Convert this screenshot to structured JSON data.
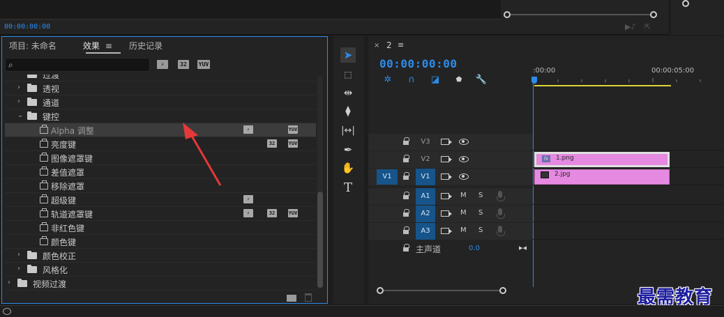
{
  "top": {
    "timecode": "00:00:00:00"
  },
  "effects_panel": {
    "tabs": [
      {
        "label": "项目: 未命名"
      },
      {
        "label": "效果"
      },
      {
        "label": "历史记录"
      }
    ],
    "active_tab": "效果",
    "search": {
      "value": "",
      "placeholder": ""
    },
    "filter_badges": [
      "accel-badge-icon",
      "32-bit-badge-icon",
      "yuv-badge-icon"
    ],
    "filter_badge_labels": [
      "⚡",
      "32",
      "YUV"
    ],
    "tree": [
      {
        "label": "过渡",
        "type": "folder",
        "depth": 1,
        "collapsed": true
      },
      {
        "label": "透视",
        "type": "folder",
        "depth": 1,
        "collapsed": true
      },
      {
        "label": "通道",
        "type": "folder",
        "depth": 1,
        "collapsed": true
      },
      {
        "label": "键控",
        "type": "folder",
        "depth": 1,
        "collapsed": false
      },
      {
        "label": "Alpha 调整",
        "type": "effect",
        "depth": 2,
        "selected": true,
        "badges": [
          "accel",
          "yuv"
        ]
      },
      {
        "label": "亮度键",
        "type": "effect",
        "depth": 2,
        "badges": [
          "32",
          "yuv"
        ]
      },
      {
        "label": "图像遮罩键",
        "type": "effect",
        "depth": 2,
        "badges": []
      },
      {
        "label": "差值遮罩",
        "type": "effect",
        "depth": 2,
        "badges": []
      },
      {
        "label": "移除遮罩",
        "type": "effect",
        "depth": 2,
        "badges": []
      },
      {
        "label": "超级键",
        "type": "effect",
        "depth": 2,
        "badges": [
          "accel"
        ]
      },
      {
        "label": "轨道遮罩键",
        "type": "effect",
        "depth": 2,
        "badges": [
          "accel",
          "32",
          "yuv"
        ]
      },
      {
        "label": "非红色键",
        "type": "effect",
        "depth": 2,
        "badges": []
      },
      {
        "label": "颜色键",
        "type": "effect",
        "depth": 2,
        "badges": []
      },
      {
        "label": "颜色校正",
        "type": "folder",
        "depth": 1,
        "collapsed": true
      },
      {
        "label": "风格化",
        "type": "folder",
        "depth": 1,
        "collapsed": true
      },
      {
        "label": "视频过渡",
        "type": "folder",
        "depth": 0,
        "collapsed": true
      }
    ]
  },
  "tools": [
    "selection-tool-icon",
    "track-select-tool-icon",
    "ripple-edit-tool-icon",
    "razor-tool-icon",
    "slip-tool-icon",
    "pen-tool-icon",
    "hand-tool-icon",
    "type-tool-icon"
  ],
  "timeline": {
    "sequence_name": "2",
    "timecode": "00:00:00:00",
    "ruler": {
      "start": ":00:00",
      "end": "00:00:05:00"
    },
    "video_tracks": [
      {
        "name": "V3",
        "targeted": false,
        "source": ""
      },
      {
        "name": "V2",
        "targeted": false,
        "source": ""
      },
      {
        "name": "V1",
        "targeted": true,
        "source": "V1"
      }
    ],
    "audio_tracks": [
      {
        "name": "A1",
        "mute": "M",
        "solo": "S"
      },
      {
        "name": "A2",
        "mute": "M",
        "solo": "S"
      },
      {
        "name": "A3",
        "mute": "M",
        "solo": "S"
      }
    ],
    "master": {
      "label": "主声道",
      "value": "0.0"
    },
    "clips": [
      {
        "name": "1.png",
        "track": "V2",
        "fx": "fx"
      },
      {
        "name": "2.jpg",
        "track": "V1"
      }
    ],
    "accent_color": "#2d8ceb",
    "clip_color": "#e589e1"
  },
  "watermark": "最需教育"
}
